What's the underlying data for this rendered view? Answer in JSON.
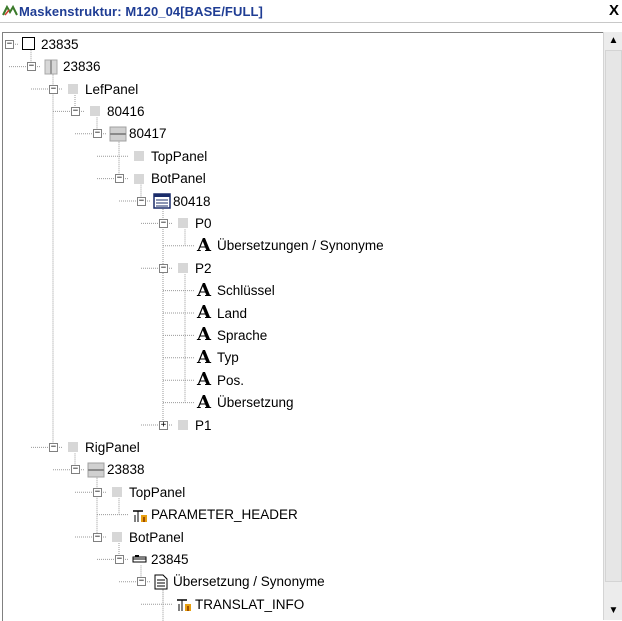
{
  "window": {
    "title": "Maskenstruktur: M120_04[BASE/FULL]",
    "close_label": "X"
  },
  "scrollbar": {
    "up_glyph": "▲",
    "down_glyph": "▼"
  },
  "tree": [
    {
      "id": "n0",
      "label": "23835",
      "depth": 0,
      "icon": "frame-icon",
      "expander": "−"
    },
    {
      "id": "n1",
      "label": "23836",
      "depth": 1,
      "icon": "split-panel-icon",
      "expander": "−"
    },
    {
      "id": "n2",
      "label": "LefPanel",
      "depth": 2,
      "icon": "panel-icon",
      "expander": "−"
    },
    {
      "id": "n3",
      "label": "80416",
      "depth": 3,
      "icon": "panel-icon",
      "expander": "−"
    },
    {
      "id": "n4",
      "label": "80417",
      "depth": 4,
      "icon": "split-panel-h-icon",
      "expander": "−"
    },
    {
      "id": "n5",
      "label": "TopPanel",
      "depth": 5,
      "icon": "panel-icon",
      "expander": ""
    },
    {
      "id": "n6",
      "label": "BotPanel",
      "depth": 5,
      "icon": "panel-icon",
      "expander": "−"
    },
    {
      "id": "n7",
      "label": "80418",
      "depth": 6,
      "icon": "notebook-icon",
      "expander": "−"
    },
    {
      "id": "n8",
      "label": "P0",
      "depth": 7,
      "icon": "panel-icon",
      "expander": "−"
    },
    {
      "id": "n9",
      "label": "Übersetzungen / Synonyme",
      "depth": 8,
      "icon": "label-text-icon",
      "expander": ""
    },
    {
      "id": "n10",
      "label": "P2",
      "depth": 7,
      "icon": "panel-icon",
      "expander": "−"
    },
    {
      "id": "n11",
      "label": "Schlüssel",
      "depth": 8,
      "icon": "label-text-icon",
      "expander": ""
    },
    {
      "id": "n12",
      "label": "Land",
      "depth": 8,
      "icon": "label-text-icon",
      "expander": ""
    },
    {
      "id": "n13",
      "label": "Sprache",
      "depth": 8,
      "icon": "label-text-icon",
      "expander": ""
    },
    {
      "id": "n14",
      "label": "Typ",
      "depth": 8,
      "icon": "label-text-icon",
      "expander": ""
    },
    {
      "id": "n15",
      "label": "Pos.",
      "depth": 8,
      "icon": "label-text-icon",
      "expander": ""
    },
    {
      "id": "n16",
      "label": "Übersetzung",
      "depth": 8,
      "icon": "label-text-icon",
      "expander": ""
    },
    {
      "id": "n17",
      "label": "P1",
      "depth": 7,
      "icon": "panel-icon",
      "expander": "+"
    },
    {
      "id": "n18",
      "label": "RigPanel",
      "depth": 2,
      "icon": "panel-icon",
      "expander": "−"
    },
    {
      "id": "n19",
      "label": "23838",
      "depth": 3,
      "icon": "split-panel-h-icon",
      "expander": "−"
    },
    {
      "id": "n20",
      "label": "TopPanel",
      "depth": 4,
      "icon": "panel-icon",
      "expander": "−"
    },
    {
      "id": "n21",
      "label": "PARAMETER_HEADER",
      "depth": 5,
      "icon": "subform-icon",
      "expander": ""
    },
    {
      "id": "n22",
      "label": "BotPanel",
      "depth": 4,
      "icon": "panel-icon",
      "expander": "−"
    },
    {
      "id": "n23",
      "label": "23845",
      "depth": 5,
      "icon": "toolbar-icon",
      "expander": "−"
    },
    {
      "id": "n24",
      "label": "Übersetzung / Synonyme",
      "depth": 6,
      "icon": "document-icon",
      "expander": "−"
    },
    {
      "id": "n25",
      "label": "TRANSLAT_INFO",
      "depth": 7,
      "icon": "subform-icon",
      "expander": ""
    }
  ]
}
